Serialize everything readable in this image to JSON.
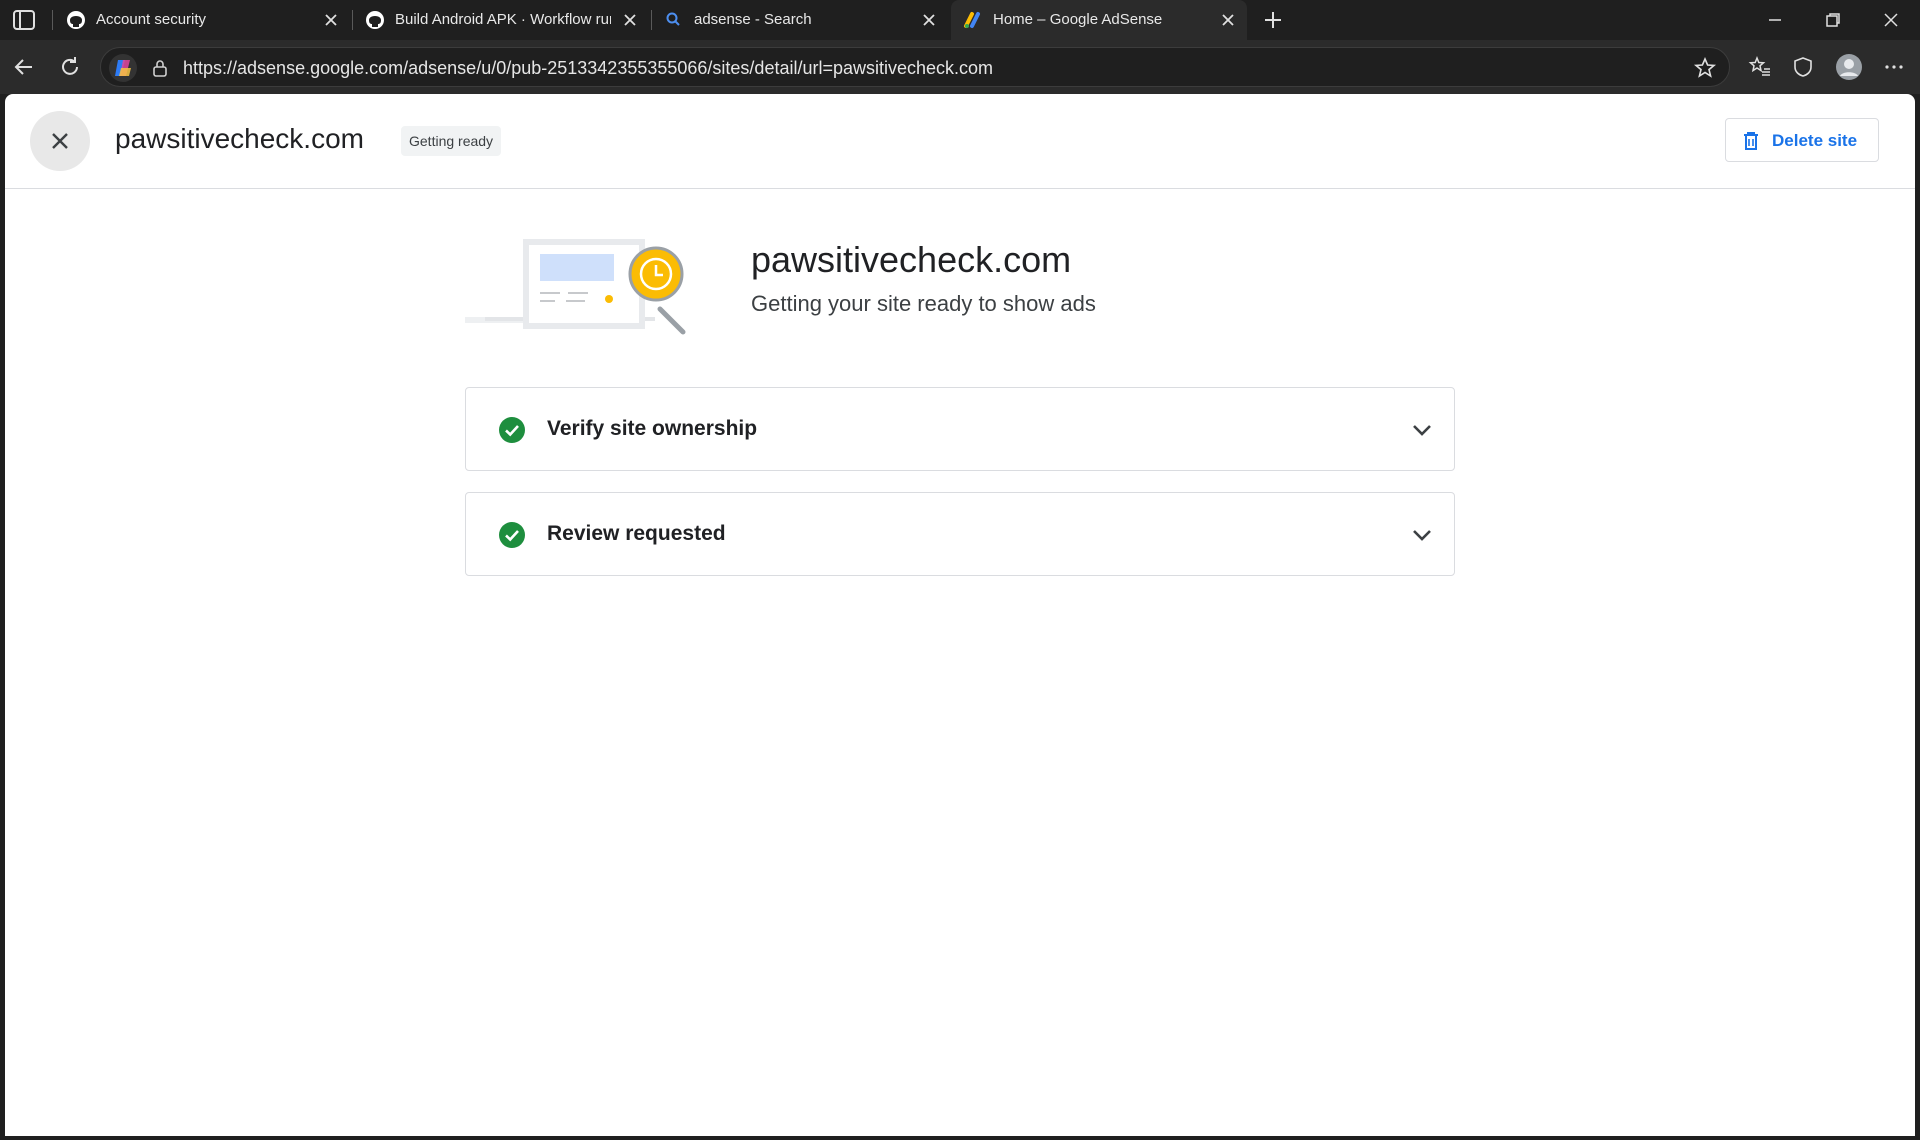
{
  "browser": {
    "tabs": [
      {
        "title": "Account security",
        "icon": "github-icon",
        "active": false
      },
      {
        "title": "Build Android APK · Workflow runs",
        "icon": "github-icon",
        "active": false
      },
      {
        "title": "adsense - Search",
        "icon": "search-icon",
        "active": false
      },
      {
        "title": "Home – Google AdSense",
        "icon": "adsense-icon",
        "active": true
      }
    ],
    "url": "https://adsense.google.com/adsense/u/0/pub-2513342355355066/sites/detail/url=pawsitivecheck.com"
  },
  "header": {
    "site_name": "pawsitivecheck.com",
    "status": "Getting ready",
    "delete_label": "Delete site"
  },
  "hero": {
    "title": "pawsitivecheck.com",
    "subtitle": "Getting your site ready to show ads"
  },
  "steps": [
    {
      "label": "Verify site ownership",
      "done": true
    },
    {
      "label": "Review requested",
      "done": true
    }
  ],
  "colors": {
    "accent": "#1a73e8",
    "success": "#1e8e3e",
    "illustration_yellow": "#fbbc04"
  }
}
